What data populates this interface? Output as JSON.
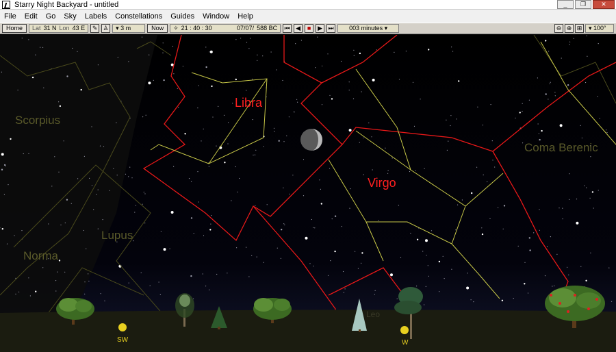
{
  "window": {
    "title": "Starry Night Backyard - untitled",
    "minimize": "_",
    "restore": "❐",
    "close": "✕"
  },
  "menu": [
    "File",
    "Edit",
    "Go",
    "Sky",
    "Labels",
    "Constellations",
    "Guides",
    "Window",
    "Help"
  ],
  "toolbar": {
    "home": "Home",
    "lat_label": "Lat",
    "lat_value": "31 N",
    "lon_label": "Lon",
    "lon_value": "43 E",
    "elevation": "▾ 3 m",
    "now": "Now",
    "time": "21 : 40 : 30",
    "date": "07/07/",
    "year": "588 BC",
    "timestep": "003 minutes ▾",
    "fov": "▾ 100°",
    "playback": [
      "⏮",
      "◀",
      "■",
      "▶",
      "⏭"
    ],
    "zoom_icons": [
      "⊖",
      "⊕",
      "⊞"
    ]
  },
  "sky": {
    "constellations_highlight": [
      {
        "name": "Libra",
        "color": "#ff2020"
      },
      {
        "name": "Virgo",
        "color": "#ff2020"
      }
    ],
    "constellations_faint": [
      "Scorpius",
      "Lupus",
      "Norma",
      "Coma Berenic"
    ],
    "faint_color": "#5a5a2a",
    "horizon_labels": [
      {
        "text": "SW"
      },
      {
        "text": "W"
      }
    ],
    "horizon_faint_text": "Leo",
    "colors": {
      "boundary": "#ff1010",
      "line": "#c8c848",
      "ground": "#1e1e10"
    }
  }
}
